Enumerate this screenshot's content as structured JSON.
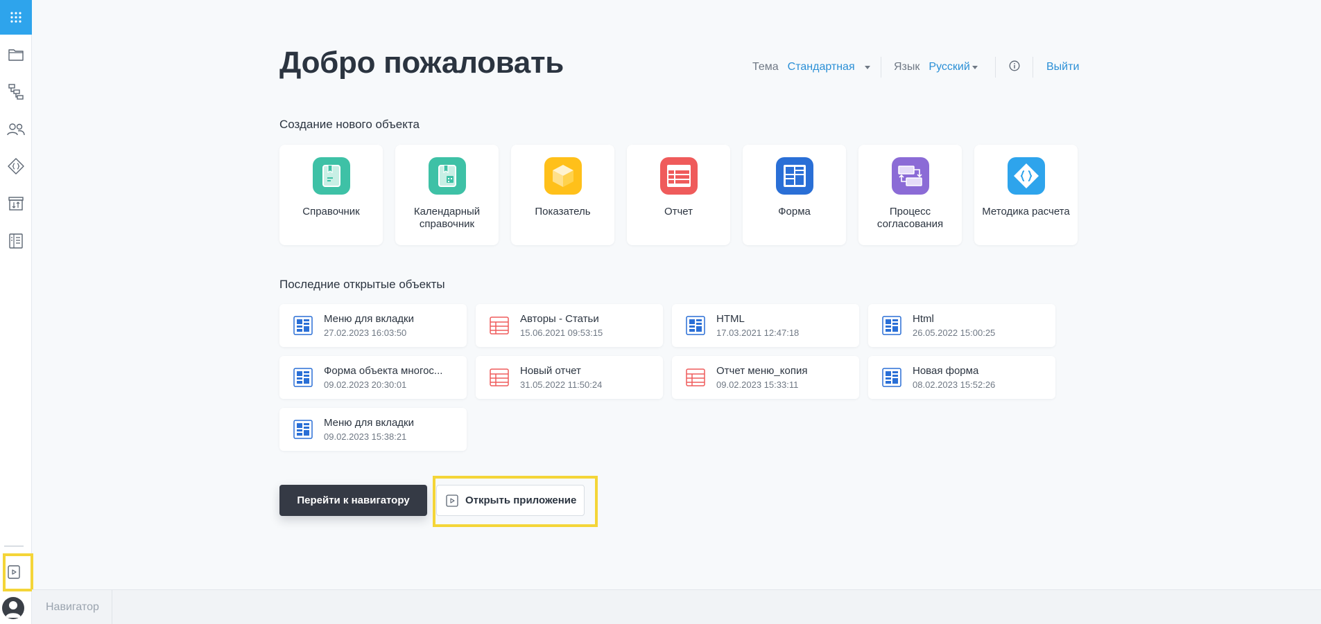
{
  "sidebar": {
    "items": [
      {
        "icon": "apps-grid-icon"
      },
      {
        "icon": "folder-icon"
      },
      {
        "icon": "hierarchy-icon"
      },
      {
        "icon": "users-icon"
      },
      {
        "icon": "code-diamond-icon"
      },
      {
        "icon": "archive-transfer-icon"
      },
      {
        "icon": "book-icon"
      },
      {
        "icon": "play-app-icon"
      }
    ],
    "accent_color": "#2ea4ec"
  },
  "header": {
    "title": "Добро пожаловать",
    "theme_label": "Тема",
    "theme_value": "Стандартная",
    "language_label": "Язык",
    "language_value": "Русский",
    "logout_label": "Выйти"
  },
  "create": {
    "title": "Создание нового объекта",
    "items": [
      {
        "label": "Справочник",
        "color": "#3ec1a6"
      },
      {
        "label": "Календарный справочник",
        "color": "#3ec1a6"
      },
      {
        "label": "Показатель",
        "color": "#ffc01a"
      },
      {
        "label": "Отчет",
        "color": "#ef5b5b"
      },
      {
        "label": "Форма",
        "color": "#2a6fd6"
      },
      {
        "label": "Процесс согласования",
        "color": "#8b6bd6"
      },
      {
        "label": "Методика расчета",
        "color": "#2ea4ec"
      }
    ]
  },
  "recent": {
    "title": "Последние открытые объекты",
    "items": [
      {
        "name": "Меню для вкладки",
        "date": "27.02.2023 16:03:50",
        "type": "form"
      },
      {
        "name": "Авторы - Статьи",
        "date": "15.06.2021 09:53:15",
        "type": "report"
      },
      {
        "name": "HTML",
        "date": "17.03.2021 12:47:18",
        "type": "form"
      },
      {
        "name": "Html",
        "date": "26.05.2022 15:00:25",
        "type": "form"
      },
      {
        "name": "Форма объекта многос...",
        "date": "09.02.2023 20:30:01",
        "type": "form"
      },
      {
        "name": "Новый отчет",
        "date": "31.05.2022 11:50:24",
        "type": "report"
      },
      {
        "name": "Отчет меню_копия",
        "date": "09.02.2023 15:33:11",
        "type": "report"
      },
      {
        "name": "Новая форма",
        "date": "08.02.2023 15:52:26",
        "type": "form"
      },
      {
        "name": "Меню для вкладки",
        "date": "09.02.2023 15:38:21",
        "type": "form"
      }
    ]
  },
  "actions": {
    "navigator_button": "Перейти к навигатору",
    "open_app_button": "Открыть приложение"
  },
  "bottombar": {
    "tab_label": "Навигатор"
  }
}
